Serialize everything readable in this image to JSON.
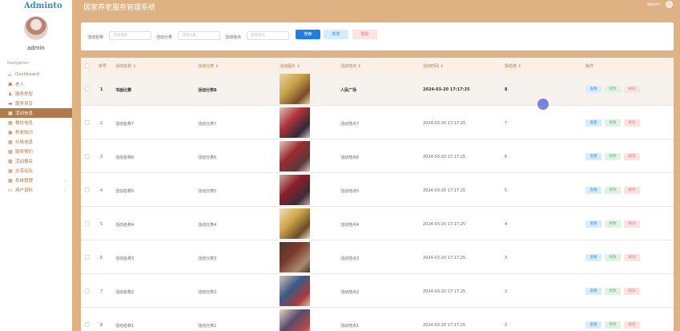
{
  "app": {
    "logo": "Adminto",
    "title": "居家养老服务管理系统",
    "username": "admin",
    "header_user": "admin",
    "accent": "#deb282",
    "nav_active_color": "#b07a4a"
  },
  "sidebar": {
    "nav_label": "Navigation",
    "items": [
      {
        "label": "Dashboard",
        "icon": "home-icon"
      },
      {
        "label": "老人",
        "icon": "user-icon"
      },
      {
        "label": "服务类型",
        "icon": "person-icon"
      },
      {
        "label": "服务项目",
        "icon": "folder-icon"
      },
      {
        "label": "活动信息",
        "icon": "grid-icon",
        "active": true
      },
      {
        "label": "餐饮信息",
        "icon": "grid-icon"
      },
      {
        "label": "养老知识",
        "icon": "lock-icon"
      },
      {
        "label": "价格信息",
        "icon": "grid-icon"
      },
      {
        "label": "服务预约",
        "icon": "grid-icon"
      },
      {
        "label": "活动报名",
        "icon": "grid-icon"
      },
      {
        "label": "交流论坛",
        "icon": "grid-icon"
      },
      {
        "label": "系统管理",
        "icon": "grid-icon",
        "chevron": true
      },
      {
        "label": "用户资料",
        "icon": "card-icon",
        "chevron": true
      }
    ]
  },
  "search": {
    "fields": [
      {
        "label": "活动名称",
        "placeholder": "活动名称"
      },
      {
        "label": "活动分类",
        "placeholder": "活动分类"
      },
      {
        "label": "活动地点",
        "placeholder": "活动地点"
      }
    ],
    "search_btn": "搜索",
    "add_btn": "新增",
    "delete_btn": "删除"
  },
  "table": {
    "headers": [
      "序号",
      "活动名称 ⇕",
      "活动分类 ⇕",
      "活动图片 ⇕",
      "活动地点 ⇕",
      "活动时间 ⇕",
      "报名数 ⇕",
      "操作"
    ],
    "op_labels": {
      "view": "查看",
      "edit": "修改",
      "delete": "删除"
    },
    "rows": [
      {
        "index": "1",
        "name": "书画比赛",
        "category": "活动分类8",
        "location": "人民广场",
        "time": "2024-03-20 17:17:25",
        "signups": "8",
        "highlight": true,
        "image": "photo-1"
      },
      {
        "index": "2",
        "name": "活动名称7",
        "category": "活动分类7",
        "location": "活动地点7",
        "time": "2024-03-20 17:17:25",
        "signups": "7",
        "image": "photo-2"
      },
      {
        "index": "3",
        "name": "活动名称6",
        "category": "活动分类6",
        "location": "活动地点6",
        "time": "2024-03-20 17:17:25",
        "signups": "6",
        "image": "photo-3"
      },
      {
        "index": "4",
        "name": "活动名称5",
        "category": "活动分类5",
        "location": "活动地点5",
        "time": "2024-03-20 17:17:25",
        "signups": "5",
        "image": "photo-4"
      },
      {
        "index": "5",
        "name": "活动名称4",
        "category": "活动分类4",
        "location": "活动地点4",
        "time": "2024-03-20 17:17:25",
        "signups": "4",
        "image": "photo-5"
      },
      {
        "index": "6",
        "name": "活动名称3",
        "category": "活动分类3",
        "location": "活动地点3",
        "time": "2024-03-20 17:17:25",
        "signups": "3",
        "image": "photo-6"
      },
      {
        "index": "7",
        "name": "活动名称2",
        "category": "活动分类2",
        "location": "活动地点2",
        "time": "2024-03-20 17:17:25",
        "signups": "2",
        "image": "photo-7"
      },
      {
        "index": "8",
        "name": "活动名称1",
        "category": "活动分类1",
        "location": "活动地点1",
        "time": "2024-03-20 17:17:25",
        "signups": "2",
        "image": "photo-8"
      }
    ]
  }
}
